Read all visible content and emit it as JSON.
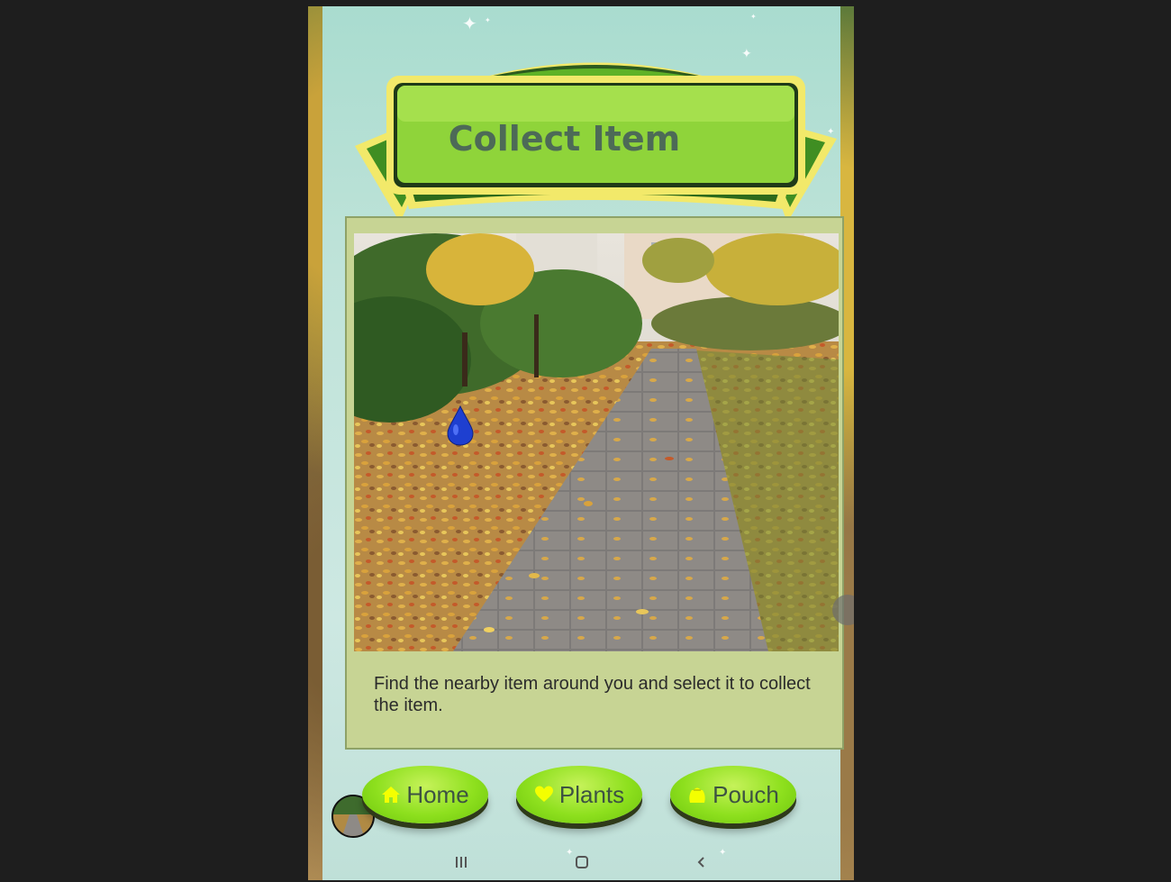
{
  "header": {
    "title": "Collect Item"
  },
  "content": {
    "instruction": "Find the nearby item around you and select it to collect the item."
  },
  "nav": {
    "home_label": "Home",
    "plants_label": "Plants",
    "pouch_label": "Pouch",
    "icons": [
      "home-icon",
      "heart-icon",
      "bag-icon"
    ]
  },
  "colors": {
    "banner_green": "#8fd43a",
    "banner_border": "#f2e96a",
    "panel_bg": "#c7d494",
    "button_green": "#8ee01e",
    "icon_yellow": "#f4ff00",
    "water_drop": "#1e3fd0"
  },
  "system_bar": {
    "icons": [
      "recent-apps-icon",
      "home-circle-icon",
      "back-icon"
    ]
  }
}
